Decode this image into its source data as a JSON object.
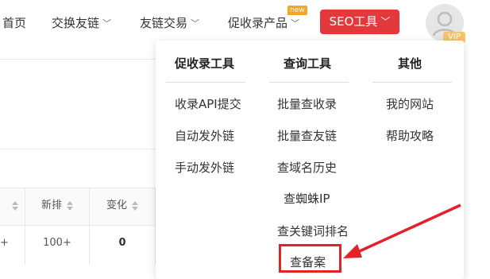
{
  "nav": {
    "home": "首页",
    "exchange": "交换友链",
    "trade": "友链交易",
    "products": "促收录产品",
    "new_badge": "new",
    "seo_tools": "SEO工具",
    "vip": "VIP"
  },
  "table": {
    "headers": [
      "新排",
      "变化"
    ],
    "row": [
      "+",
      "100+",
      "0"
    ]
  },
  "dropdown": {
    "col1": {
      "title": "促收录工具",
      "items": [
        "收录API提交",
        "自动发外链",
        "手动发外链"
      ]
    },
    "col2": {
      "title": "查询工具",
      "items": [
        "批量查收录",
        "批量查友链",
        "查域名历史",
        "查蜘蛛IP",
        "查关键词排名",
        "查备案"
      ]
    },
    "col3": {
      "title": "其他",
      "items": [
        "我的网站",
        "帮助攻略"
      ]
    }
  },
  "colors": {
    "accent": "#e4393c",
    "annotation": "#e4212a",
    "badge": "#f5a623"
  }
}
